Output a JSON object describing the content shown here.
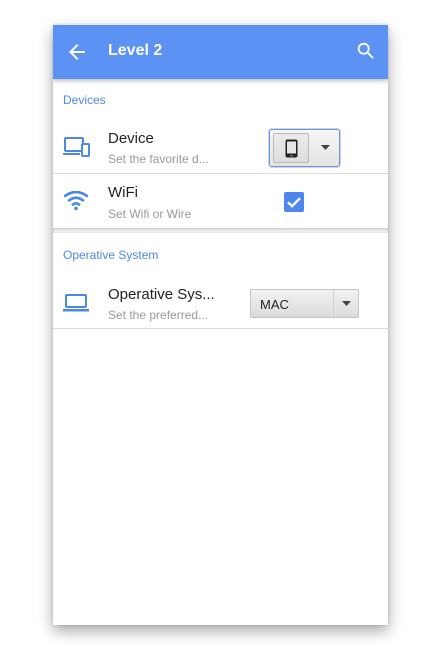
{
  "appbar": {
    "title": "Level 2",
    "back_icon": "arrow-back-icon",
    "search_icon": "search-icon",
    "background_color": "#5b92f4"
  },
  "sections": {
    "devices": {
      "header": "Devices",
      "device_row": {
        "icon": "devices-icon",
        "title": "Device",
        "subtitle": "Set the favorite d...",
        "selected_option_icon": "smartphone-icon"
      },
      "wifi_row": {
        "icon": "wifi-icon",
        "title": "WiFi",
        "subtitle": "Set Wifi or Wire",
        "checked": true
      }
    },
    "os": {
      "header": "Operative System",
      "os_row": {
        "icon": "laptop-icon",
        "title": "Operative Sys...",
        "subtitle": "Set the preferred...",
        "selected_value": "MAC"
      }
    }
  },
  "colors": {
    "accent": "#4a8ae6",
    "checkbox": "#4f86ec"
  }
}
